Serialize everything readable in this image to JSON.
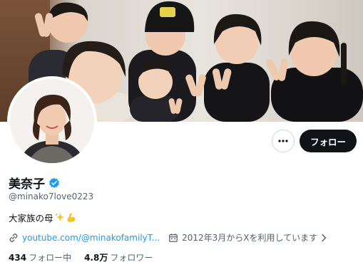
{
  "profile": {
    "display_name": "美奈子",
    "verified_badge": "blue-check-icon",
    "handle": "@minako7love0223",
    "bio_text": "大家族の母",
    "bio_emoji": [
      "sparkles-icon",
      "flexed-biceps-icon"
    ],
    "website_label": "youtube.com/@minakofamilyT...",
    "joined_label": "2012年3月からXを利用しています",
    "following_count": "434",
    "following_label": "フォロー中",
    "followers_count": "4.8万",
    "followers_label": "フォロワー"
  },
  "actions": {
    "more_label": "···",
    "follow_label": "フォロー"
  },
  "colors": {
    "link_blue": "#1d9bf0",
    "text_primary": "#0f1419",
    "text_secondary": "#536471",
    "button_dark": "#0f1419"
  }
}
